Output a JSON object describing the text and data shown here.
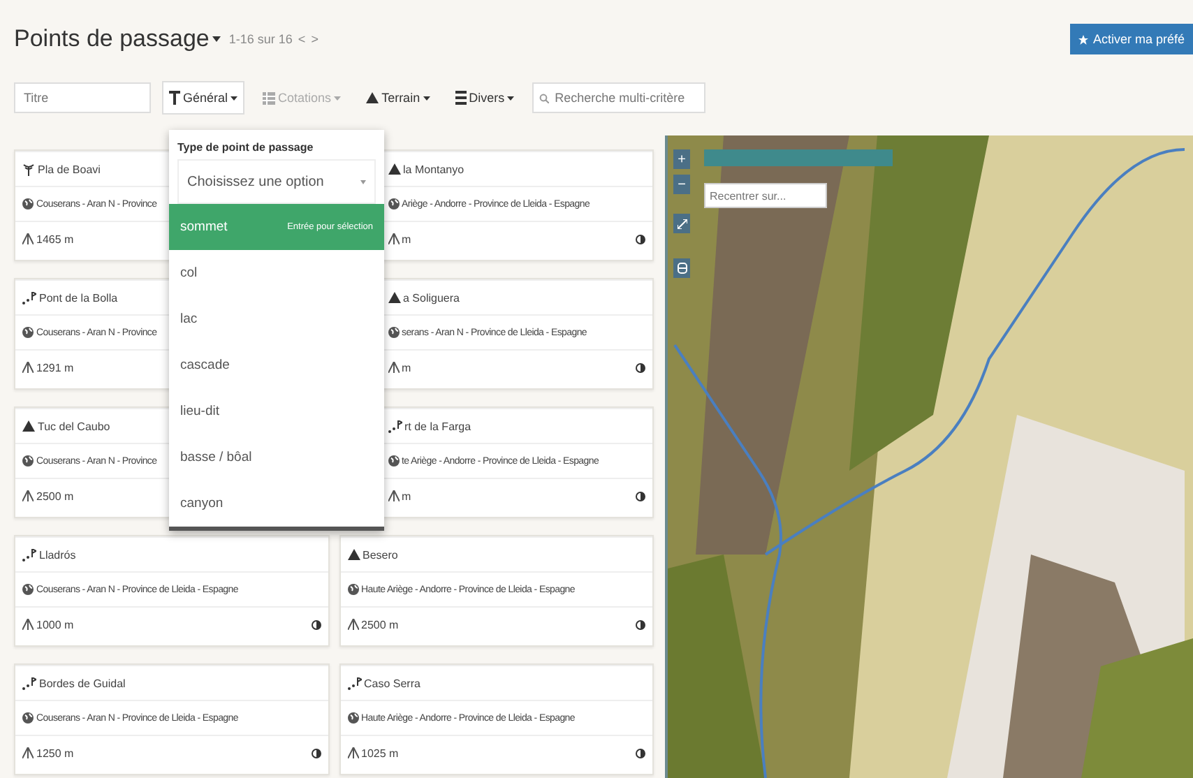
{
  "header": {
    "title": "Points de passage",
    "pager": "1-16 sur 16",
    "prev": "<",
    "next": ">",
    "action_button": "Activer ma préfé"
  },
  "filters": {
    "title_placeholder": "Titre",
    "menus": [
      {
        "label": "Général",
        "kind": "filter",
        "disabled": false,
        "open": true
      },
      {
        "label": "Cotations",
        "kind": "grid",
        "disabled": true,
        "open": false
      },
      {
        "label": "Terrain",
        "kind": "peak",
        "disabled": false,
        "open": false
      },
      {
        "label": "Divers",
        "kind": "list",
        "disabled": false,
        "open": false
      }
    ],
    "search_placeholder": "Recherche multi-critère"
  },
  "dropdown": {
    "label": "Type de point de passage",
    "select_placeholder": "Choisissez une option",
    "hint": "Entrée pour sélection",
    "options": [
      {
        "label": "sommet",
        "selected": true
      },
      {
        "label": "col",
        "selected": false
      },
      {
        "label": "lac",
        "selected": false
      },
      {
        "label": "cascade",
        "selected": false
      },
      {
        "label": "lieu-dit",
        "selected": false
      },
      {
        "label": "basse / bôal",
        "selected": false
      },
      {
        "label": "canyon",
        "selected": false
      }
    ]
  },
  "cards": [
    {
      "kind": "antenna",
      "title": "Pla de Boavi",
      "location": "Couserans - Aran N - Province",
      "altitude": "1465 m",
      "covered": false
    },
    {
      "kind": "peak",
      "title": "la Montanyo",
      "location": "Ariège - Andorre - Province de Lleida - Espagne",
      "altitude": "m",
      "covered": true
    },
    {
      "kind": "place",
      "title": "Pont de la Bolla",
      "location": "Couserans - Aran N - Province",
      "altitude": "1291 m",
      "covered": false
    },
    {
      "kind": "peak",
      "title": "a Soliguera",
      "location": "serans - Aran N - Province de Lleida - Espagne",
      "altitude": "m",
      "covered": true
    },
    {
      "kind": "peak",
      "title": "Tuc del Caubo",
      "location": "Couserans - Aran N - Province",
      "altitude": "2500 m",
      "covered": false
    },
    {
      "kind": "place",
      "title": "rt de la Farga",
      "location": "te Ariège - Andorre - Province de Lleida - Espagne",
      "altitude": "m",
      "covered": true
    },
    {
      "kind": "place",
      "title": "Lladrós",
      "location": "Couserans - Aran N - Province de Lleida - Espagne",
      "altitude": "1000 m",
      "covered": false
    },
    {
      "kind": "peak",
      "title": "Besero",
      "location": "Haute Ariège - Andorre - Province de Lleida - Espagne",
      "altitude": "2500 m",
      "covered": false
    },
    {
      "kind": "place",
      "title": "Bordes de Guidal",
      "location": "Couserans - Aran N - Province de Lleida - Espagne",
      "altitude": "1250 m",
      "covered": false
    },
    {
      "kind": "place",
      "title": "Caso Serra",
      "location": "Haute Ariège - Andorre - Province de Lleida - Espagne",
      "altitude": "1025 m",
      "covered": false
    }
  ],
  "map": {
    "zoom_in": "+",
    "zoom_out": "−",
    "search_placeholder": "Recentrer sur..."
  }
}
